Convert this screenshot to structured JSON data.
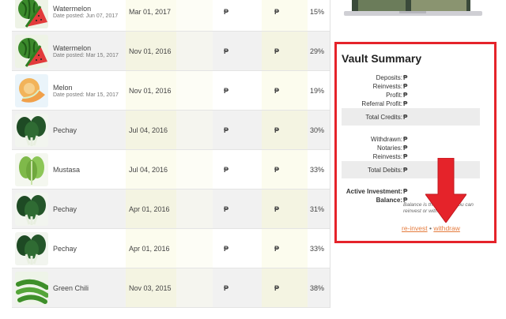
{
  "rows": [
    {
      "name": "Watermelon",
      "posted": "Date posted: Jun 07, 2017",
      "date": "Mar 01, 2017",
      "peso_a": "₱",
      "peso_b": "₱",
      "pct": "15%",
      "icon": "watermelon-icon"
    },
    {
      "name": "Watermelon",
      "posted": "Date posted: Mar 15, 2017",
      "date": "Nov 01, 2016",
      "peso_a": "₱",
      "peso_b": "₱",
      "pct": "29%",
      "icon": "watermelon-icon"
    },
    {
      "name": "Melon",
      "posted": "Date posted: Mar 15, 2017",
      "date": "Nov 01, 2016",
      "peso_a": "₱",
      "peso_b": "₱",
      "pct": "19%",
      "icon": "melon-icon"
    },
    {
      "name": "Pechay",
      "posted": "",
      "date": "Jul 04, 2016",
      "peso_a": "₱",
      "peso_b": "₱",
      "pct": "30%",
      "icon": "pechay-icon"
    },
    {
      "name": "Mustasa",
      "posted": "",
      "date": "Jul 04, 2016",
      "peso_a": "₱",
      "peso_b": "₱",
      "pct": "33%",
      "icon": "mustasa-icon"
    },
    {
      "name": "Pechay",
      "posted": "",
      "date": "Apr 01, 2016",
      "peso_a": "₱",
      "peso_b": "₱",
      "pct": "31%",
      "icon": "pechay-icon"
    },
    {
      "name": "Pechay",
      "posted": "",
      "date": "Apr 01, 2016",
      "peso_a": "₱",
      "peso_b": "₱",
      "pct": "33%",
      "icon": "pechay-icon"
    },
    {
      "name": "Green Chili",
      "posted": "",
      "date": "Nov 03, 2015",
      "peso_a": "₱",
      "peso_b": "₱",
      "pct": "38%",
      "icon": "green-chili-icon"
    }
  ],
  "vault": {
    "title": "Vault Summary",
    "deposits": "Deposits:",
    "reinvests": "Reinvests:",
    "profit": "Profit:",
    "referral_profit": "Referral Profit:",
    "total_credits": "Total Credits:",
    "withdrawn": "Withdrawn:",
    "notaries": "Notaries:",
    "reinvests2": "Reinvests:",
    "total_debits": "Total Debits:",
    "active_investment": "Active Investment:",
    "balance": "Balance:",
    "peso": "₱",
    "balance_note": "Balance is the amount you can reinvest or withdraw.",
    "reinvest_link": "re-invest",
    "separator": "•",
    "withdraw_link": "withdraw"
  },
  "colors": {
    "accent_red": "#e5232a",
    "link_orange": "#e57c3e"
  }
}
